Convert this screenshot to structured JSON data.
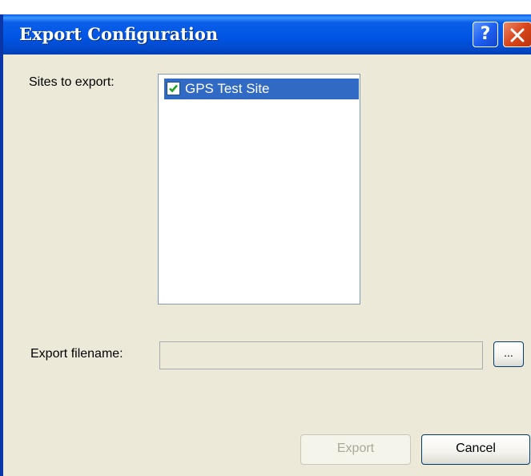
{
  "window": {
    "title": "Export Configuration",
    "help_glyph": "?"
  },
  "form": {
    "sites_label": "Sites to export:",
    "sites": [
      {
        "label": "GPS Test Site",
        "checked": true,
        "selected": true
      }
    ],
    "filename_label": "Export filename:",
    "filename_value": "",
    "browse_label": "..."
  },
  "buttons": {
    "export_label": "Export",
    "export_enabled": false,
    "cancel_label": "Cancel"
  },
  "colors": {
    "titlebar": "#0054e3",
    "selection": "#316ac5",
    "check": "#21a121",
    "dialog_background": "#ece9d8"
  },
  "icons": {
    "help": "help-icon",
    "close": "close-icon",
    "check": "checkmark-icon"
  }
}
